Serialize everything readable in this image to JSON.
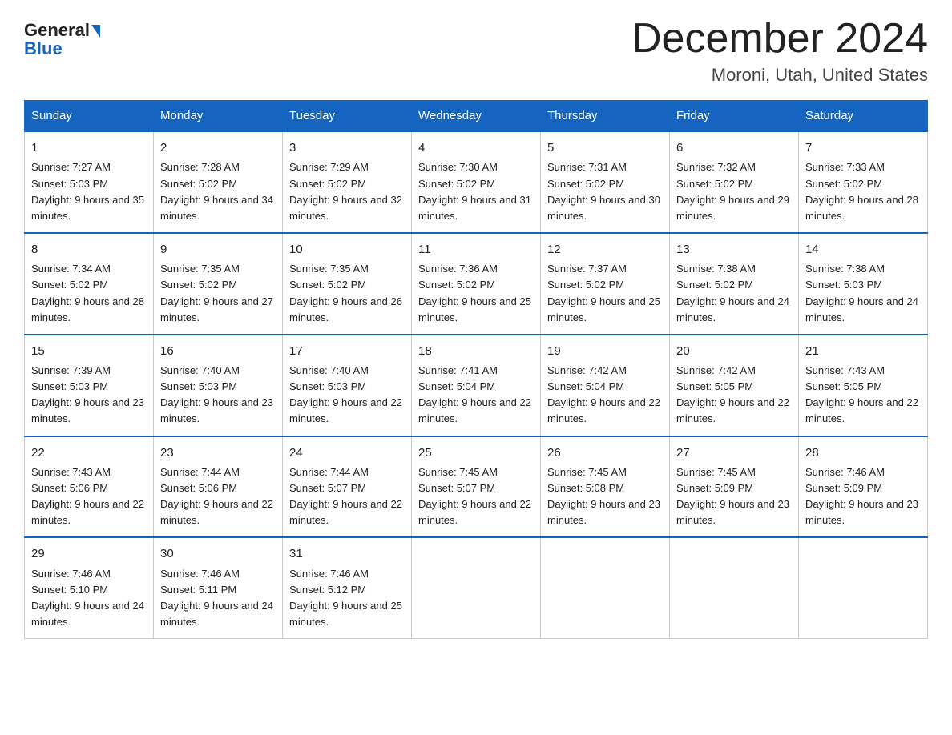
{
  "header": {
    "logo_general": "General",
    "logo_blue": "Blue",
    "month_title": "December 2024",
    "location": "Moroni, Utah, United States"
  },
  "days_of_week": [
    "Sunday",
    "Monday",
    "Tuesday",
    "Wednesday",
    "Thursday",
    "Friday",
    "Saturday"
  ],
  "weeks": [
    [
      {
        "day": "1",
        "sunrise": "7:27 AM",
        "sunset": "5:03 PM",
        "daylight": "9 hours and 35 minutes."
      },
      {
        "day": "2",
        "sunrise": "7:28 AM",
        "sunset": "5:02 PM",
        "daylight": "9 hours and 34 minutes."
      },
      {
        "day": "3",
        "sunrise": "7:29 AM",
        "sunset": "5:02 PM",
        "daylight": "9 hours and 32 minutes."
      },
      {
        "day": "4",
        "sunrise": "7:30 AM",
        "sunset": "5:02 PM",
        "daylight": "9 hours and 31 minutes."
      },
      {
        "day": "5",
        "sunrise": "7:31 AM",
        "sunset": "5:02 PM",
        "daylight": "9 hours and 30 minutes."
      },
      {
        "day": "6",
        "sunrise": "7:32 AM",
        "sunset": "5:02 PM",
        "daylight": "9 hours and 29 minutes."
      },
      {
        "day": "7",
        "sunrise": "7:33 AM",
        "sunset": "5:02 PM",
        "daylight": "9 hours and 28 minutes."
      }
    ],
    [
      {
        "day": "8",
        "sunrise": "7:34 AM",
        "sunset": "5:02 PM",
        "daylight": "9 hours and 28 minutes."
      },
      {
        "day": "9",
        "sunrise": "7:35 AM",
        "sunset": "5:02 PM",
        "daylight": "9 hours and 27 minutes."
      },
      {
        "day": "10",
        "sunrise": "7:35 AM",
        "sunset": "5:02 PM",
        "daylight": "9 hours and 26 minutes."
      },
      {
        "day": "11",
        "sunrise": "7:36 AM",
        "sunset": "5:02 PM",
        "daylight": "9 hours and 25 minutes."
      },
      {
        "day": "12",
        "sunrise": "7:37 AM",
        "sunset": "5:02 PM",
        "daylight": "9 hours and 25 minutes."
      },
      {
        "day": "13",
        "sunrise": "7:38 AM",
        "sunset": "5:02 PM",
        "daylight": "9 hours and 24 minutes."
      },
      {
        "day": "14",
        "sunrise": "7:38 AM",
        "sunset": "5:03 PM",
        "daylight": "9 hours and 24 minutes."
      }
    ],
    [
      {
        "day": "15",
        "sunrise": "7:39 AM",
        "sunset": "5:03 PM",
        "daylight": "9 hours and 23 minutes."
      },
      {
        "day": "16",
        "sunrise": "7:40 AM",
        "sunset": "5:03 PM",
        "daylight": "9 hours and 23 minutes."
      },
      {
        "day": "17",
        "sunrise": "7:40 AM",
        "sunset": "5:03 PM",
        "daylight": "9 hours and 22 minutes."
      },
      {
        "day": "18",
        "sunrise": "7:41 AM",
        "sunset": "5:04 PM",
        "daylight": "9 hours and 22 minutes."
      },
      {
        "day": "19",
        "sunrise": "7:42 AM",
        "sunset": "5:04 PM",
        "daylight": "9 hours and 22 minutes."
      },
      {
        "day": "20",
        "sunrise": "7:42 AM",
        "sunset": "5:05 PM",
        "daylight": "9 hours and 22 minutes."
      },
      {
        "day": "21",
        "sunrise": "7:43 AM",
        "sunset": "5:05 PM",
        "daylight": "9 hours and 22 minutes."
      }
    ],
    [
      {
        "day": "22",
        "sunrise": "7:43 AM",
        "sunset": "5:06 PM",
        "daylight": "9 hours and 22 minutes."
      },
      {
        "day": "23",
        "sunrise": "7:44 AM",
        "sunset": "5:06 PM",
        "daylight": "9 hours and 22 minutes."
      },
      {
        "day": "24",
        "sunrise": "7:44 AM",
        "sunset": "5:07 PM",
        "daylight": "9 hours and 22 minutes."
      },
      {
        "day": "25",
        "sunrise": "7:45 AM",
        "sunset": "5:07 PM",
        "daylight": "9 hours and 22 minutes."
      },
      {
        "day": "26",
        "sunrise": "7:45 AM",
        "sunset": "5:08 PM",
        "daylight": "9 hours and 23 minutes."
      },
      {
        "day": "27",
        "sunrise": "7:45 AM",
        "sunset": "5:09 PM",
        "daylight": "9 hours and 23 minutes."
      },
      {
        "day": "28",
        "sunrise": "7:46 AM",
        "sunset": "5:09 PM",
        "daylight": "9 hours and 23 minutes."
      }
    ],
    [
      {
        "day": "29",
        "sunrise": "7:46 AM",
        "sunset": "5:10 PM",
        "daylight": "9 hours and 24 minutes."
      },
      {
        "day": "30",
        "sunrise": "7:46 AM",
        "sunset": "5:11 PM",
        "daylight": "9 hours and 24 minutes."
      },
      {
        "day": "31",
        "sunrise": "7:46 AM",
        "sunset": "5:12 PM",
        "daylight": "9 hours and 25 minutes."
      },
      null,
      null,
      null,
      null
    ]
  ]
}
